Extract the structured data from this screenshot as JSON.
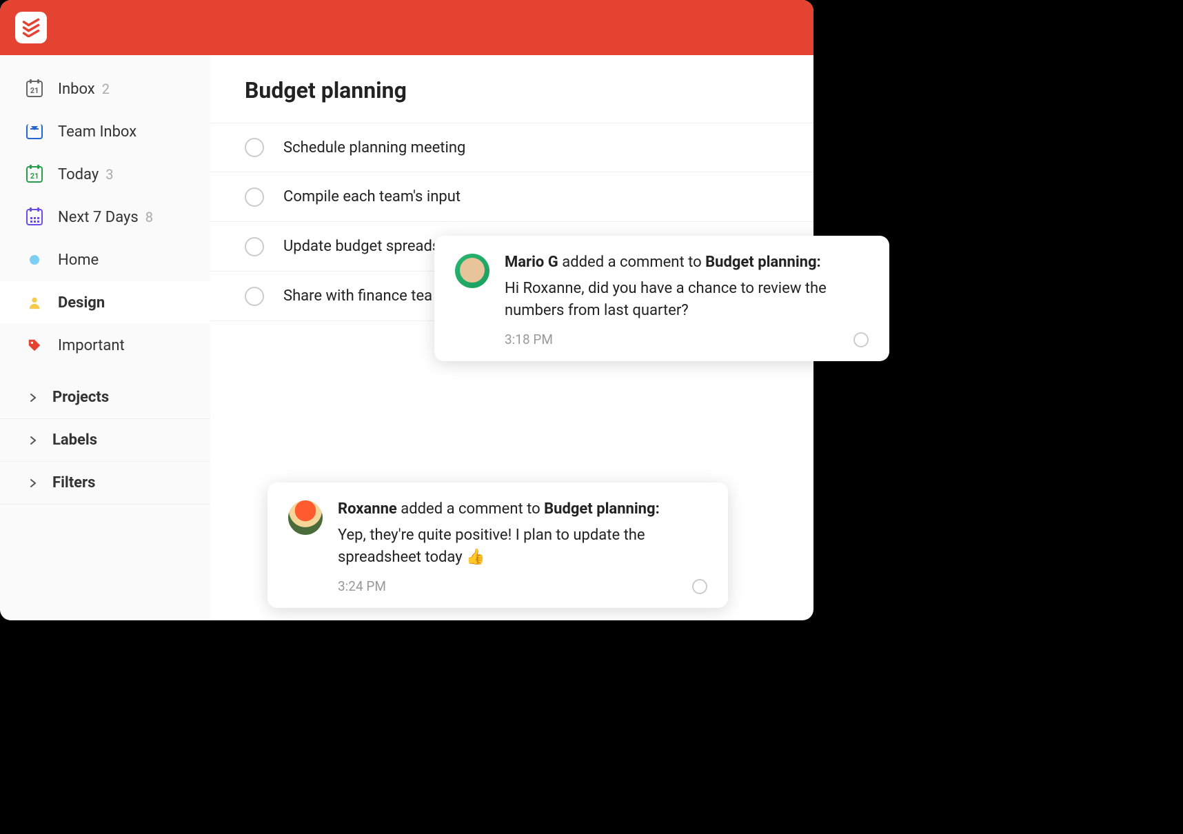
{
  "sidebar": {
    "items": [
      {
        "label": "Inbox",
        "count": "2"
      },
      {
        "label": "Team Inbox"
      },
      {
        "label": "Today",
        "count": "3"
      },
      {
        "label": "Next 7 Days",
        "count": "8"
      },
      {
        "label": "Home"
      },
      {
        "label": "Design"
      },
      {
        "label": "Important"
      }
    ],
    "sections": [
      {
        "label": "Projects"
      },
      {
        "label": "Labels"
      },
      {
        "label": "Filters"
      }
    ]
  },
  "main": {
    "title": "Budget planning",
    "tasks": [
      {
        "label": "Schedule planning meeting"
      },
      {
        "label": "Compile each team's input"
      },
      {
        "label": "Update budget spreadsheet"
      },
      {
        "label": "Share with finance tea"
      }
    ]
  },
  "notifications": [
    {
      "author": "Mario G",
      "action": " added a comment to ",
      "target": "Budget planning:",
      "message": "Hi Roxanne, did you have a chance to review the numbers from last quarter?",
      "time": "3:18 PM"
    },
    {
      "author": "Roxanne",
      "action": " added a comment to ",
      "target": "Budget planning:",
      "message": "Yep, they're quite positive! I plan to update the spreadsheet today 👍",
      "time": "3:24 PM"
    }
  ]
}
